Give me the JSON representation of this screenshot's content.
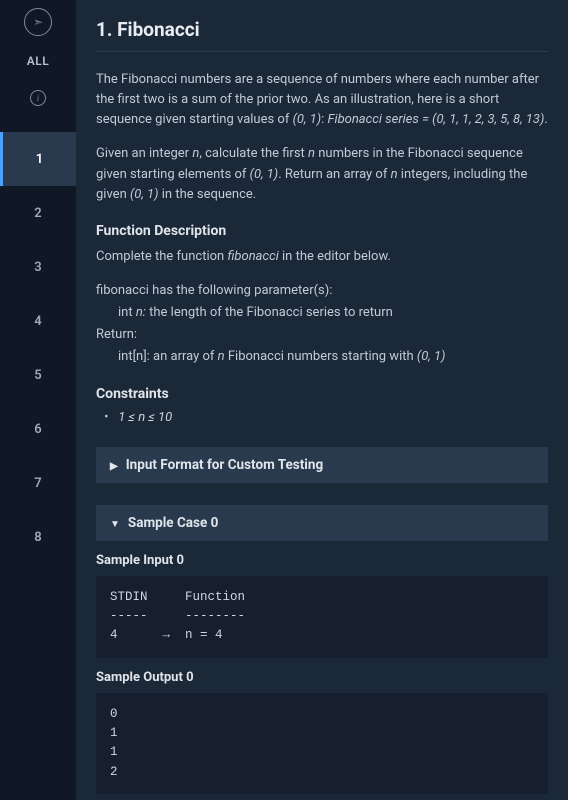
{
  "sidebar": {
    "compass_icon": "➣",
    "all_label": "ALL",
    "info_icon": "i",
    "items": [
      {
        "label": "1",
        "active": true
      },
      {
        "label": "2",
        "active": false
      },
      {
        "label": "3",
        "active": false
      },
      {
        "label": "4",
        "active": false
      },
      {
        "label": "5",
        "active": false
      },
      {
        "label": "6",
        "active": false
      },
      {
        "label": "7",
        "active": false
      },
      {
        "label": "8",
        "active": false
      }
    ]
  },
  "problem": {
    "title": "1. Fibonacci",
    "intro_part1": "The Fibonacci numbers are a sequence of numbers where each number after the first two is a sum of the prior two. As an illustration, here is a short sequence given starting values of ",
    "intro_values": "(0, 1)",
    "intro_colon": ": ",
    "intro_series_label": "Fibonacci series = (0, 1, 1, 2, 3, 5, 8, 13)",
    "intro_period": ".",
    "task_part1": "Given an integer ",
    "task_n1": "n",
    "task_part2": ", calculate the first ",
    "task_n2": "n",
    "task_part3": " numbers in the Fibonacci sequence given starting elements of ",
    "task_values": "(0, 1)",
    "task_part4": ". Return an array of ",
    "task_n3": "n",
    "task_part5": " integers, including the given ",
    "task_values2": "(0, 1)",
    "task_part6": " in the sequence.",
    "func_desc_heading": "Function Description",
    "func_desc_text1": "Complete the function ",
    "func_desc_name": "fibonacci",
    "func_desc_text2": " in the editor below.",
    "params_intro": "fibonacci has the following parameter(s):",
    "param_line1a": "int ",
    "param_line1b": "n:",
    "param_line1c": "  the length of the Fibonacci series to return",
    "return_label": "Return:",
    "return_line1a": "int[n]: an array of ",
    "return_line1b": "n",
    "return_line1c": " Fibonacci numbers starting with ",
    "return_line1d": "(0, 1)",
    "constraints_heading": "Constraints",
    "constraint1": "1 ≤ n ≤ 10",
    "collapsible1": "Input Format for Custom Testing",
    "collapsible2": "Sample Case 0",
    "sample_input_label": "Sample Input 0",
    "sample_input_code": "STDIN     Function\n-----     --------\n4      →  n = 4",
    "sample_output_label": "Sample Output 0",
    "sample_output_code": "0\n1\n1\n2"
  }
}
